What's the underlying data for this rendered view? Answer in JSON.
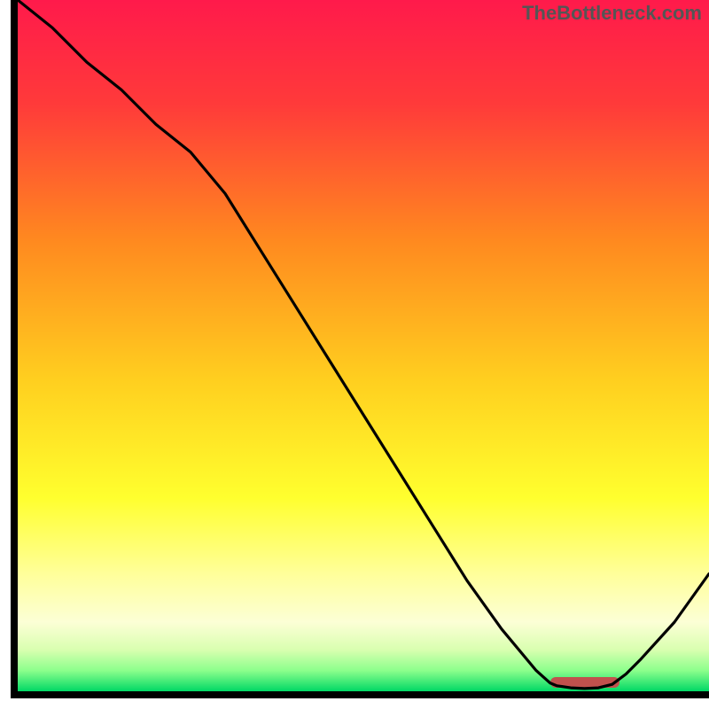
{
  "watermark": "TheBottleneck.com",
  "chart_data": {
    "type": "line",
    "title": "",
    "xlabel": "",
    "ylabel": "",
    "xlim": [
      0,
      100
    ],
    "ylim": [
      0,
      100
    ],
    "x": [
      0,
      5,
      10,
      15,
      20,
      25,
      30,
      35,
      40,
      45,
      50,
      55,
      60,
      65,
      70,
      75,
      77,
      78,
      80,
      82,
      84,
      86,
      88,
      90,
      95,
      100
    ],
    "y": [
      100,
      96,
      91,
      87,
      82,
      78,
      72,
      64,
      56,
      48,
      40,
      32,
      24,
      16,
      9,
      3,
      1.2,
      0.8,
      0.5,
      0.4,
      0.5,
      1,
      2.5,
      4.5,
      10,
      17
    ],
    "gradient_stops": [
      {
        "pos": 0.0,
        "color": "#ff1a4b"
      },
      {
        "pos": 0.15,
        "color": "#ff3a3a"
      },
      {
        "pos": 0.35,
        "color": "#ff8a1f"
      },
      {
        "pos": 0.55,
        "color": "#ffcf1f"
      },
      {
        "pos": 0.72,
        "color": "#ffff2e"
      },
      {
        "pos": 0.83,
        "color": "#ffff9a"
      },
      {
        "pos": 0.9,
        "color": "#fcffd6"
      },
      {
        "pos": 0.94,
        "color": "#d9ffb0"
      },
      {
        "pos": 0.97,
        "color": "#8cff8c"
      },
      {
        "pos": 1.0,
        "color": "#00d865"
      }
    ],
    "marker": {
      "x_start": 77,
      "x_end": 87,
      "color": "#c1514d"
    }
  }
}
